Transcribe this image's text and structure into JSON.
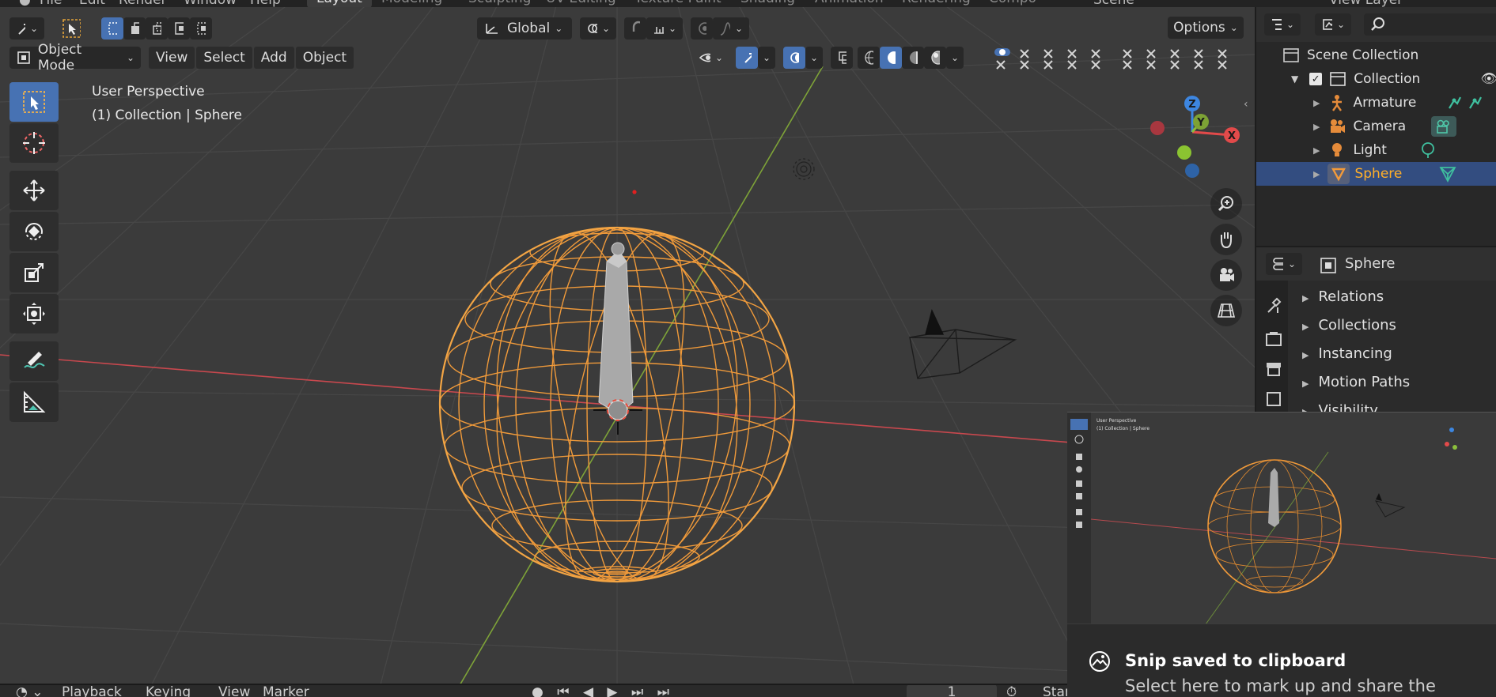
{
  "top_menu": {
    "items": [
      "File",
      "Edit",
      "Render",
      "Window",
      "Help"
    ],
    "workspace_tabs": [
      "Layout",
      "Modeling",
      "Sculpting",
      "UV Editing",
      "Texture Paint",
      "Shading",
      "Animation",
      "Rendering",
      "Compo"
    ],
    "active_tab": "Layout",
    "scene": "Scene",
    "view_layer": "View Layer"
  },
  "viewport_header": {
    "transform_orientation": "Global",
    "options_label": "Options",
    "mode": "Object Mode",
    "menus": [
      "View",
      "Select",
      "Add",
      "Object"
    ]
  },
  "viewport_overlay": {
    "perspective": "User Perspective",
    "context": "(1) Collection | Sphere"
  },
  "gizmo": {
    "x": "X",
    "y": "Y",
    "z": "Z"
  },
  "outliner": {
    "root": "Scene Collection",
    "collection": "Collection",
    "items": [
      {
        "label": "Armature",
        "icon": "armature-icon",
        "color": "#e58b3a"
      },
      {
        "label": "Camera",
        "icon": "camera-icon",
        "color": "#e58b3a"
      },
      {
        "label": "Light",
        "icon": "light-icon",
        "color": "#e58b3a"
      },
      {
        "label": "Sphere",
        "icon": "mesh-icon",
        "color": "#e58b3a",
        "selected": true
      }
    ]
  },
  "properties": {
    "object_name": "Sphere",
    "sections": [
      "Relations",
      "Collections",
      "Instancing",
      "Motion Paths",
      "Visibility"
    ]
  },
  "timeline": {
    "menus": [
      "Playback",
      "Keying",
      "View",
      "Marker"
    ],
    "frame": "1",
    "start_label": "Star"
  },
  "thumbnail": {
    "perspective": "User Perspective",
    "context": "(1) Collection | Sphere"
  },
  "toast": {
    "title": "Snip saved to clipboard",
    "subtitle": "Select here to mark up and share the"
  },
  "colors": {
    "accent_blue": "#4772b3",
    "selection_orange": "#ffaf29",
    "wire_orange": "#f09a3a",
    "grid_bg": "#3b3b3b",
    "x_axis": "#c8484e",
    "y_axis": "#7ea338"
  }
}
